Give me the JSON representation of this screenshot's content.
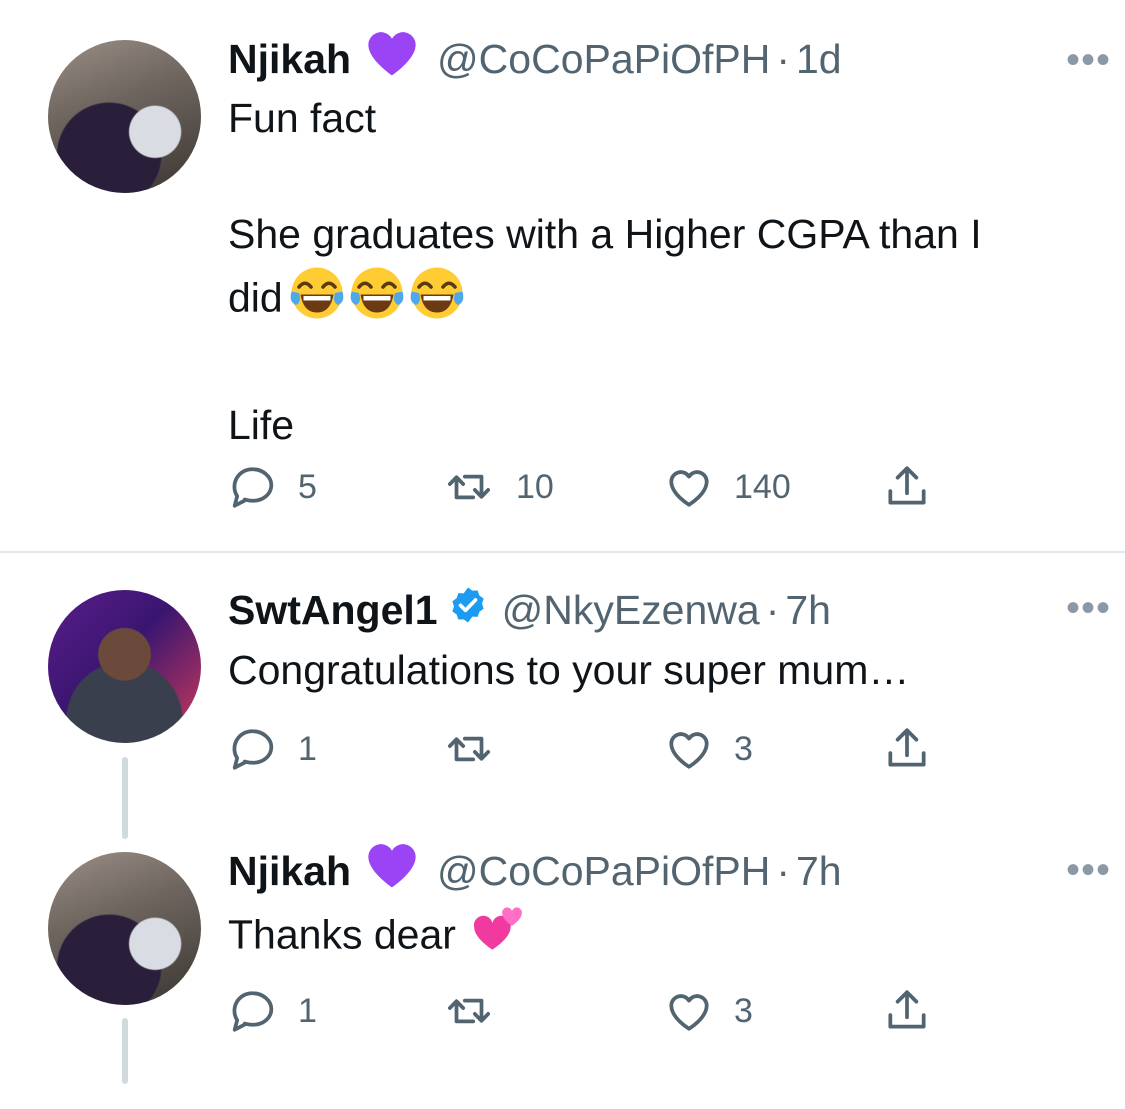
{
  "tweets": [
    {
      "name": "Njikah",
      "badge": "purple-heart",
      "handle": "@CoCoPaPiOfPH",
      "separator": "·",
      "time": "1d",
      "text": "Fun fact\n\nShe graduates with a Higher CGPA than I\ndid",
      "text_tail": "\n\nLife",
      "emoji": "face-with-tears-of-joy x3",
      "replies": "5",
      "retweets": "10",
      "likes": "140"
    },
    {
      "name": "SwtAngel1",
      "badge": "verified",
      "handle": "@NkyEzenwa",
      "separator": "·",
      "time": "7h",
      "text": "Congratulations to your super mum…",
      "replies": "1",
      "retweets": "",
      "likes": "3"
    },
    {
      "name": "Njikah",
      "badge": "purple-heart",
      "handle": "@CoCoPaPiOfPH",
      "separator": "·",
      "time": "7h",
      "text": "Thanks dear",
      "emoji": "two-hearts",
      "replies": "1",
      "retweets": "",
      "likes": "3"
    }
  ],
  "more_label": "•••",
  "colors": {
    "accent": "#1d9bf0",
    "muted": "#536471",
    "heart": "#9b44f5"
  }
}
